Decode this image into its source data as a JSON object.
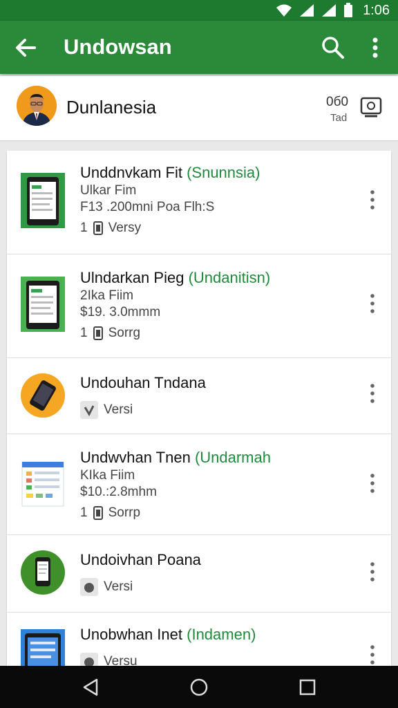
{
  "status_bar": {
    "time": "1:06"
  },
  "app_bar": {
    "title": "Undowsan"
  },
  "account": {
    "name": "Dunlanesia",
    "counter_top": "0б0",
    "counter_bottom": "Tad"
  },
  "items": [
    {
      "title": "Unddnvkam Fit",
      "tag": "(Snunnsia)",
      "line2": "Ulkar Fim",
      "line3": "F13 .200mni Poa Flh:S",
      "meta": "Versy",
      "meta_prefix": "1",
      "icon": "tablet-doc-icon"
    },
    {
      "title": "Ulndarkan Pieg",
      "tag": "(Undanitisn)",
      "line2": "2Ika Fiim",
      "line3": "$19. 3.0mmm",
      "meta": "Sorrg",
      "meta_prefix": "1",
      "icon": "tablet-doc-icon"
    },
    {
      "title": "Undouhan Tndana",
      "tag": "",
      "line2": "",
      "line3": "",
      "meta": "Versi",
      "meta_prefix": "",
      "icon": "phone-circle-icon"
    },
    {
      "title": "Undwvhan Tnen",
      "tag": "(Undarmah",
      "line2": "KIka Fiim",
      "line3": "$10.:2.8mhm",
      "meta": "Sorrp",
      "meta_prefix": "1",
      "icon": "spreadsheet-icon"
    },
    {
      "title": "Undoivhan Poana",
      "tag": "",
      "line2": "",
      "line3": "",
      "meta": "Versi",
      "meta_prefix": "",
      "icon": "phone-green-icon"
    },
    {
      "title": "Unobwhan Inet",
      "tag": "(Indamen)",
      "line2": "",
      "line3": "",
      "meta": "Versu",
      "meta_prefix": "",
      "icon": "tablet-blue-icon"
    }
  ],
  "colors": {
    "primary": "#2a8a3a",
    "status_bar": "#1e7a2e",
    "accent_text": "#1f8a3a"
  }
}
